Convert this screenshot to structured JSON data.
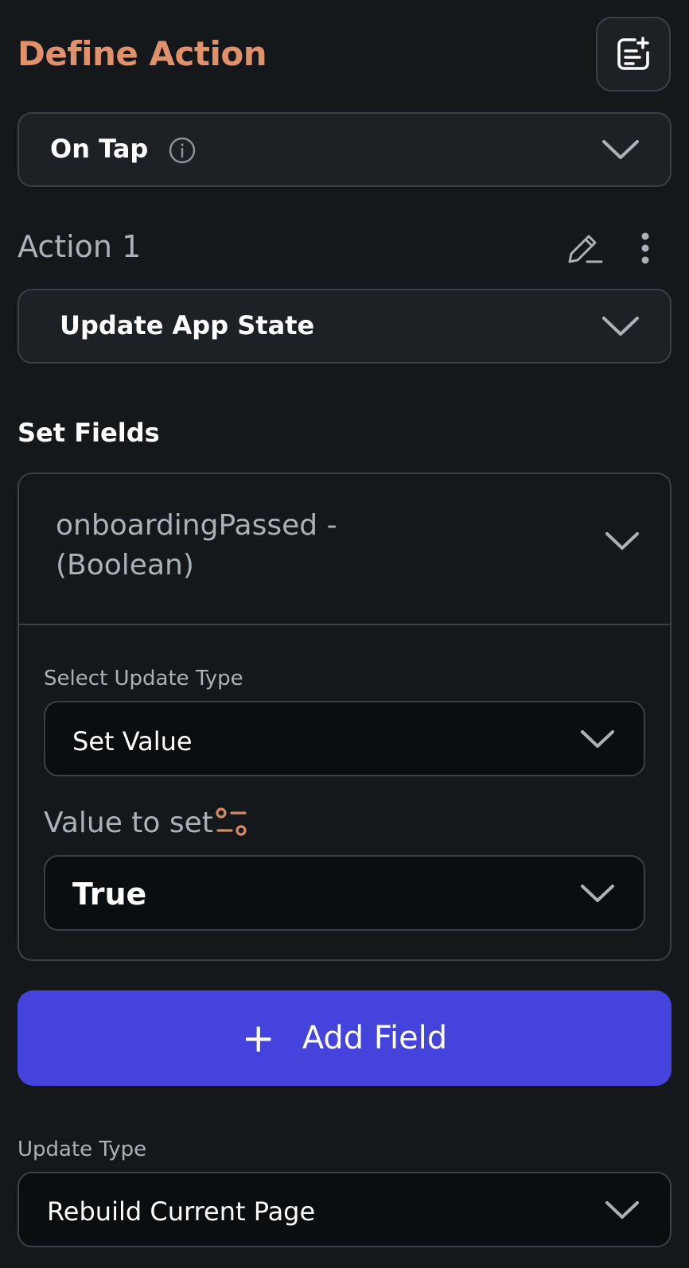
{
  "header": {
    "title": "Define Action",
    "corner_icon": "notes-add-icon"
  },
  "trigger": {
    "label": "On Tap",
    "info_icon": "info-icon"
  },
  "action": {
    "title": "Action 1",
    "type_label": "Update App State"
  },
  "set_fields": {
    "heading": "Set Fields",
    "field": {
      "name": "onboardingPassed - (Boolean)",
      "update_type_label": "Select Update Type",
      "update_type_value": "Set Value",
      "value_label": "Value to set",
      "value": "True"
    }
  },
  "add_field": {
    "plus": "+",
    "label": "Add Field"
  },
  "update_type": {
    "label": "Update Type",
    "value": "Rebuild Current Page"
  },
  "colors": {
    "background": "#14181b",
    "accent_title": "#e0916a",
    "primary_button": "#4444dd",
    "border": "#3a4048"
  }
}
